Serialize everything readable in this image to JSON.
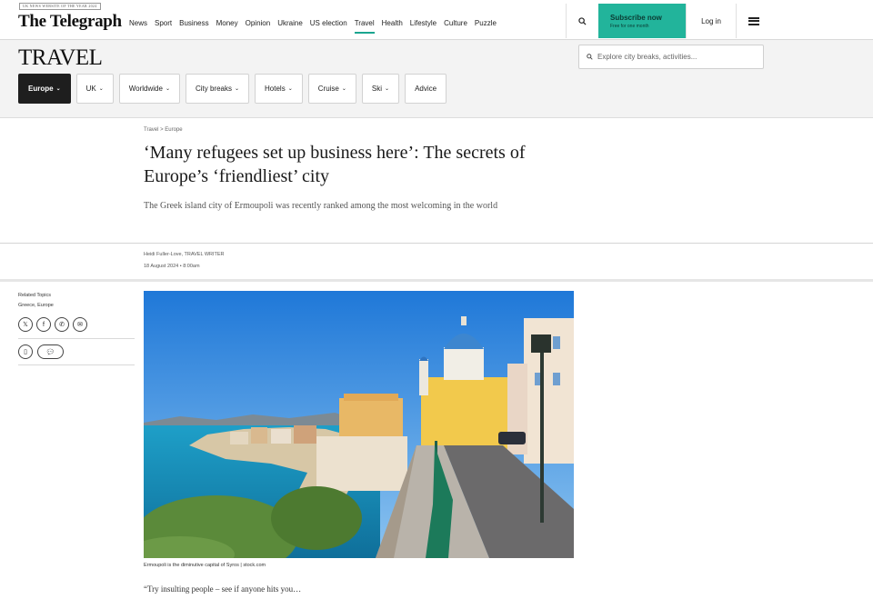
{
  "header": {
    "tagline": "UK NEWS WEBSITE OF THE YEAR 2024",
    "logo": "The Telegraph",
    "nav": [
      "News",
      "Sport",
      "Business",
      "Money",
      "Opinion",
      "Ukraine",
      "US election",
      "Travel",
      "Health",
      "Lifestyle",
      "Culture",
      "Puzzle"
    ],
    "active_nav": "Travel",
    "subscribe_label": "Subscribe now",
    "subscribe_sub": "Free for one month",
    "login_label": "Log in"
  },
  "section": {
    "title": "TRAVEL",
    "search_placeholder": "Explore city breaks, activities...",
    "subnav": [
      {
        "label": "Europe",
        "has_chevron": true,
        "active": true
      },
      {
        "label": "UK",
        "has_chevron": true,
        "active": false
      },
      {
        "label": "Worldwide",
        "has_chevron": true,
        "active": false
      },
      {
        "label": "City breaks",
        "has_chevron": true,
        "active": false
      },
      {
        "label": "Hotels",
        "has_chevron": true,
        "active": false
      },
      {
        "label": "Cruise",
        "has_chevron": true,
        "active": false
      },
      {
        "label": "Ski",
        "has_chevron": true,
        "active": false
      },
      {
        "label": "Advice",
        "has_chevron": false,
        "active": false
      }
    ]
  },
  "article": {
    "breadcrumb": "Travel > Europe",
    "headline": "‘Many refugees set up business here’: The secrets of Europe’s ‘friendliest’ city",
    "standfirst": "The Greek island city of Ermoupoli was recently ranked among the most welcoming in the world",
    "byline": "Heidi Fuller-Love, TRAVEL WRITER",
    "date": "18 August 2024 • 8:00am",
    "caption": "Ermoupoli is the diminutive capital of Syros | stock.com",
    "pullquote": "“Try insulting people – see if anyone hits you…"
  },
  "sidebar": {
    "tags": [
      "Related Topics",
      "Greece, Europe"
    ],
    "share_icons": [
      "x-icon",
      "facebook-icon",
      "whatsapp-icon",
      "email-icon"
    ]
  },
  "colors": {
    "accent": "#22b49b",
    "dark": "#1e1e1e"
  }
}
